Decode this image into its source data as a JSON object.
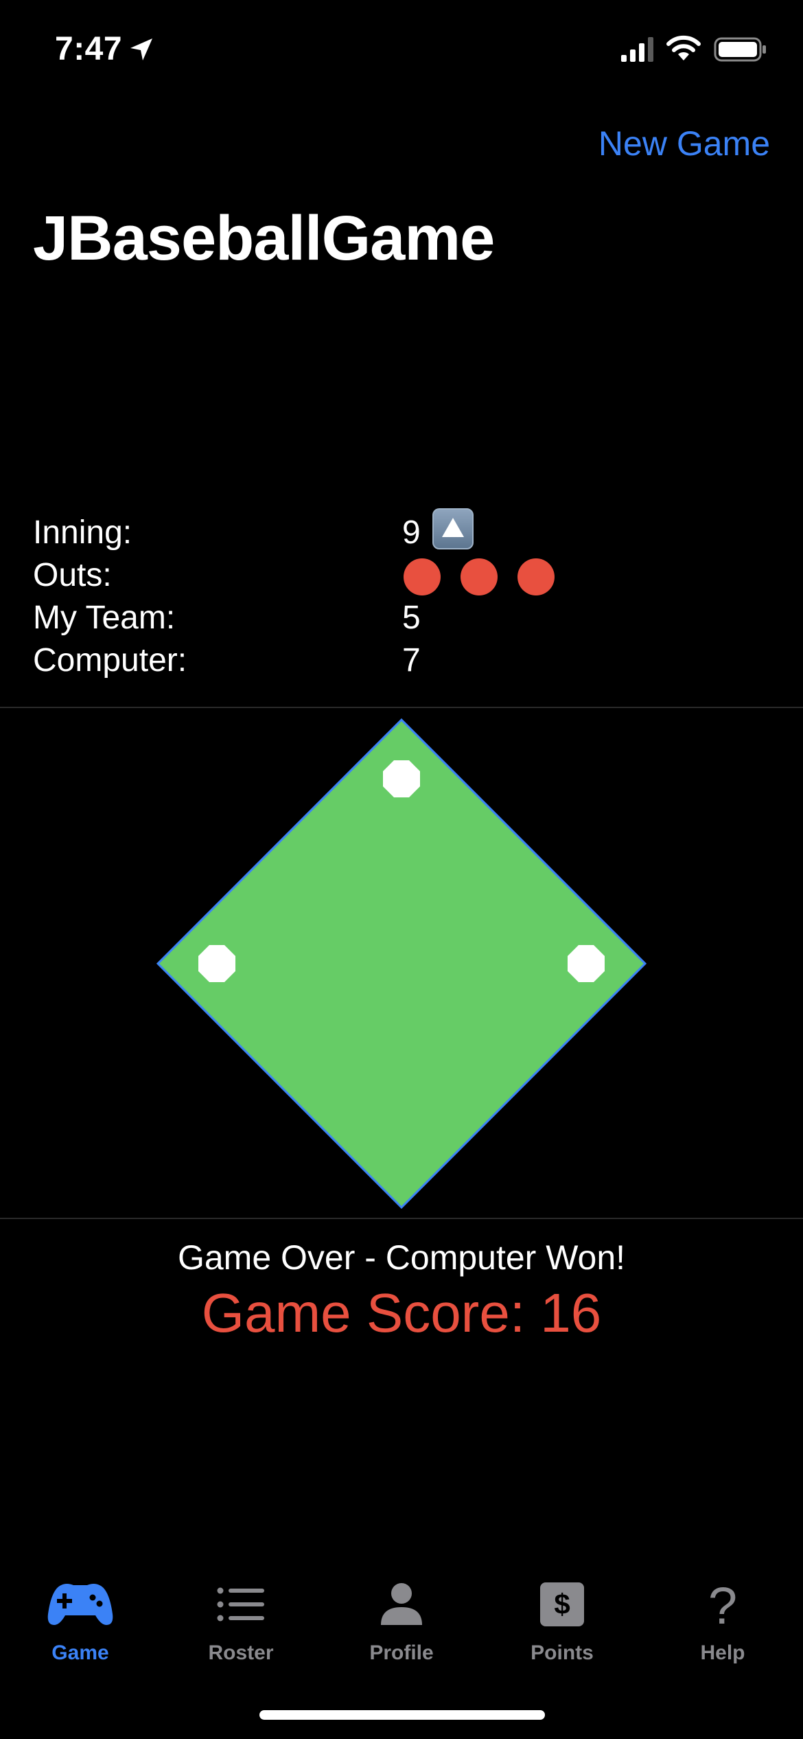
{
  "status_bar": {
    "time": "7:47",
    "icons": [
      "location-arrow-icon",
      "cellular-signal-icon",
      "wifi-icon",
      "battery-icon"
    ]
  },
  "navigation": {
    "new_game_label": "New Game"
  },
  "page_title": "JBaseballGame",
  "stats": {
    "inning": {
      "label": "Inning:",
      "value": "9",
      "half": "top",
      "indicator_icon": "up-arrow-icon"
    },
    "outs": {
      "label": "Outs:",
      "count": 3
    },
    "my_team": {
      "label": "My Team:",
      "value": "5"
    },
    "computer": {
      "label": "Computer:",
      "value": "7"
    }
  },
  "field": {
    "color": "#66cc66",
    "outline_color": "#3b82f6",
    "bases": [
      "second-base",
      "third-base",
      "first-base"
    ]
  },
  "result": {
    "message": "Game Over - Computer Won!",
    "score_text": "Game Score: 16"
  },
  "colors": {
    "accent": "#3b82f6",
    "out": "#e8503f",
    "score": "#e8503f",
    "inactive_tab": "#8a8a8e"
  },
  "tabs": [
    {
      "label": "Game",
      "icon": "gamecontroller-icon",
      "active": true
    },
    {
      "label": "Roster",
      "icon": "list-icon",
      "active": false
    },
    {
      "label": "Profile",
      "icon": "person-icon",
      "active": false
    },
    {
      "label": "Points",
      "icon": "dollar-icon",
      "active": false
    },
    {
      "label": "Help",
      "icon": "question-mark-icon",
      "active": false
    }
  ]
}
